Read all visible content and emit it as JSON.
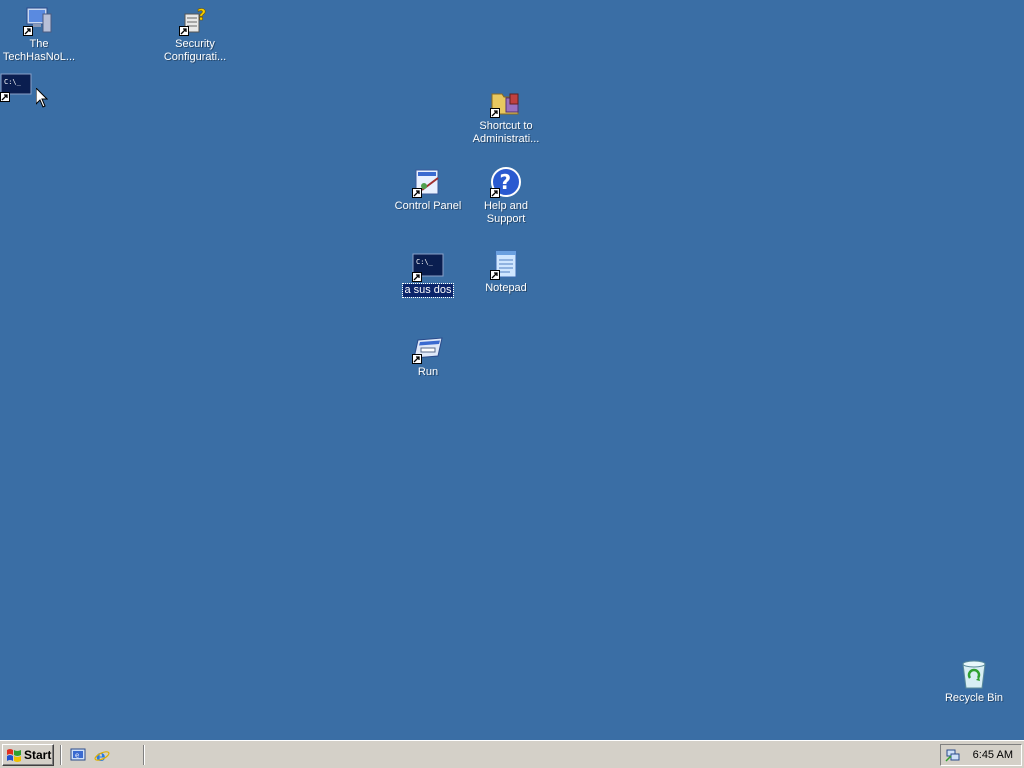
{
  "desktop": {
    "icons": {
      "techhasnolimits": "The TechHasNoL...",
      "security_config": "Security Configurati...",
      "cmd_shortcut": "",
      "admin_tools": "Shortcut to Administrati...",
      "control_panel": "Control Panel",
      "help_support": "Help and Support",
      "a_sus_dos": "a sus dos",
      "notepad": "Notepad",
      "run": "Run",
      "recycle_bin": "Recycle Bin"
    }
  },
  "taskbar": {
    "start_label": "Start",
    "quick_launch": [
      "show-desktop-icon",
      "internet-explorer-icon"
    ],
    "tray_icon": "network-icon",
    "clock": "6:45 AM"
  },
  "colors": {
    "desktop_bg": "#3a6ea5",
    "taskbar_bg": "#d4d0c8",
    "selection": "#0a246a"
  }
}
